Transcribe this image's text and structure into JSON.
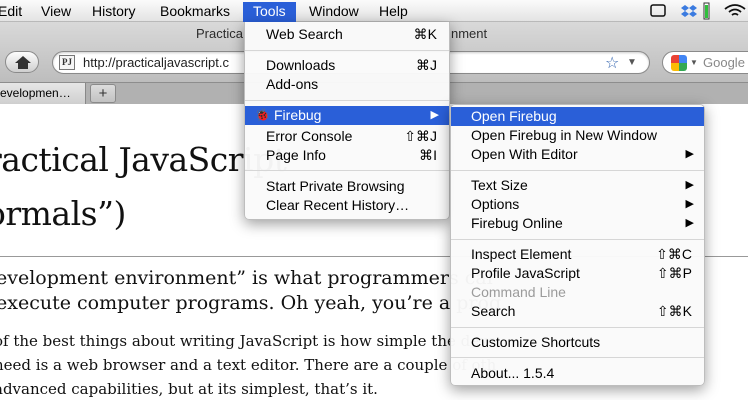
{
  "menubar": {
    "items": [
      "Edit",
      "View",
      "History",
      "Bookmarks",
      "Tools",
      "Window",
      "Help"
    ],
    "active": "Tools"
  },
  "window": {
    "title_visible": "Practica",
    "title_tail": "nment"
  },
  "toolbar": {
    "favicon_text": "PJ",
    "url": "http://practicaljavascript.c",
    "search_placeholder": "Google"
  },
  "tabs": {
    "active_tab": "evelopmen…",
    "new_tab_label": "+"
  },
  "page": {
    "heading_line1": "ractical JavaScript",
    "heading_line2": "ormals”)",
    "lead_line1": "evelopment environment” is what programmers cal",
    "lead_line2": " execute computer programs. Oh yeah, you’re a prog",
    "body_line1": "of the best things about writing JavaScript is how simple the deve",
    "body_line2": "need is a web browser and a text editor. There are a couple of oth",
    "body_line3": " advanced capabilities, but at its simplest, that’s it."
  },
  "tools_menu": {
    "items": [
      {
        "label": "Web Search",
        "shortcut": "⌘K"
      },
      {
        "label": "Downloads",
        "shortcut": "⌘J"
      },
      {
        "label": "Add-ons",
        "shortcut": ""
      },
      {
        "label": "Firebug",
        "shortcut": "",
        "submenu": true,
        "highlighted": true
      },
      {
        "label": "Error Console",
        "shortcut": "⇧⌘J"
      },
      {
        "label": "Page Info",
        "shortcut": "⌘I"
      },
      {
        "label": "Start Private Browsing",
        "shortcut": ""
      },
      {
        "label": "Clear Recent History…",
        "shortcut": ""
      }
    ]
  },
  "firebug_menu": {
    "items": [
      {
        "label": "Open Firebug",
        "highlighted": true
      },
      {
        "label": "Open Firebug in New Window"
      },
      {
        "label": "Open With Editor",
        "submenu": true
      },
      {
        "label": "Text Size",
        "submenu": true
      },
      {
        "label": "Options",
        "submenu": true
      },
      {
        "label": "Firebug Online",
        "submenu": true
      },
      {
        "label": "Inspect Element",
        "shortcut": "⇧⌘C"
      },
      {
        "label": "Profile JavaScript",
        "shortcut": "⇧⌘P"
      },
      {
        "label": "Command Line",
        "disabled": true
      },
      {
        "label": "Search",
        "shortcut": "⇧⌘K"
      },
      {
        "label": "Customize Shortcuts"
      },
      {
        "label": "About... 1.5.4"
      }
    ]
  },
  "colors": {
    "highlight": "#2a5fd8"
  }
}
